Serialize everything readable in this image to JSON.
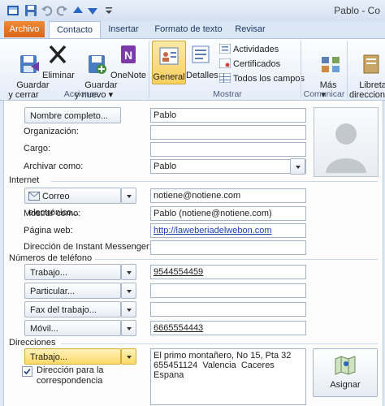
{
  "window": {
    "title": "Pablo - Co"
  },
  "tabs": [
    {
      "label": "Archivo"
    },
    {
      "label": "Contacto"
    },
    {
      "label": "Insertar"
    },
    {
      "label": "Formato de texto"
    },
    {
      "label": "Revisar"
    }
  ],
  "ribbon": {
    "actions": {
      "group": "Acciones",
      "save_close": "Guardar\ny cerrar",
      "delete": "Eliminar",
      "save_new": "Guardar\ny nuevo ▾",
      "onenote": "OneNote"
    },
    "show": {
      "group": "Mostrar",
      "general": "General",
      "details": "Detalles",
      "activities": "Actividades",
      "certificates": "Certificados",
      "all_fields": "Todos los campos"
    },
    "communicate": {
      "group": "Comunicar",
      "more": "Más\n▾"
    },
    "names": {
      "address_book": "Libreta d\ndireccione"
    }
  },
  "form": {
    "full_name_button": "Nombre completo...",
    "full_name": "Pablo",
    "company_label": "Organización:",
    "company": "",
    "job_title_label": "Cargo:",
    "job_title": "",
    "file_as_label": "Archivar como:",
    "file_as": "Pablo",
    "internet_section": "Internet",
    "email_button": "Correo electrónico...",
    "email": "notiene@notiene.com",
    "display_as_label": "Mostrar como:",
    "display_as": "Pablo (notiene@notiene.com)",
    "web_label": "Página web:",
    "web": "http://laweberiadelwebon.com",
    "im_label": "Dirección de Instant Messenger:",
    "im": "",
    "phones_section": "Números de teléfono",
    "phones": [
      {
        "button": "Trabajo...",
        "value": "9544554459"
      },
      {
        "button": "Particular...",
        "value": ""
      },
      {
        "button": "Fax del trabajo...",
        "value": ""
      },
      {
        "button": "Móvil...",
        "value": "6665554443"
      }
    ],
    "addresses_section": "Direcciones",
    "address_button": "Trabajo...",
    "address_text": "El primo montañero, No 15, Pta 32\n655451124  Valencia  Caceres\nEspana",
    "mailing_checkbox_label": "Dirección para la\ncorrespondencia",
    "mailing_checked": true,
    "map_button": "Asignar"
  }
}
